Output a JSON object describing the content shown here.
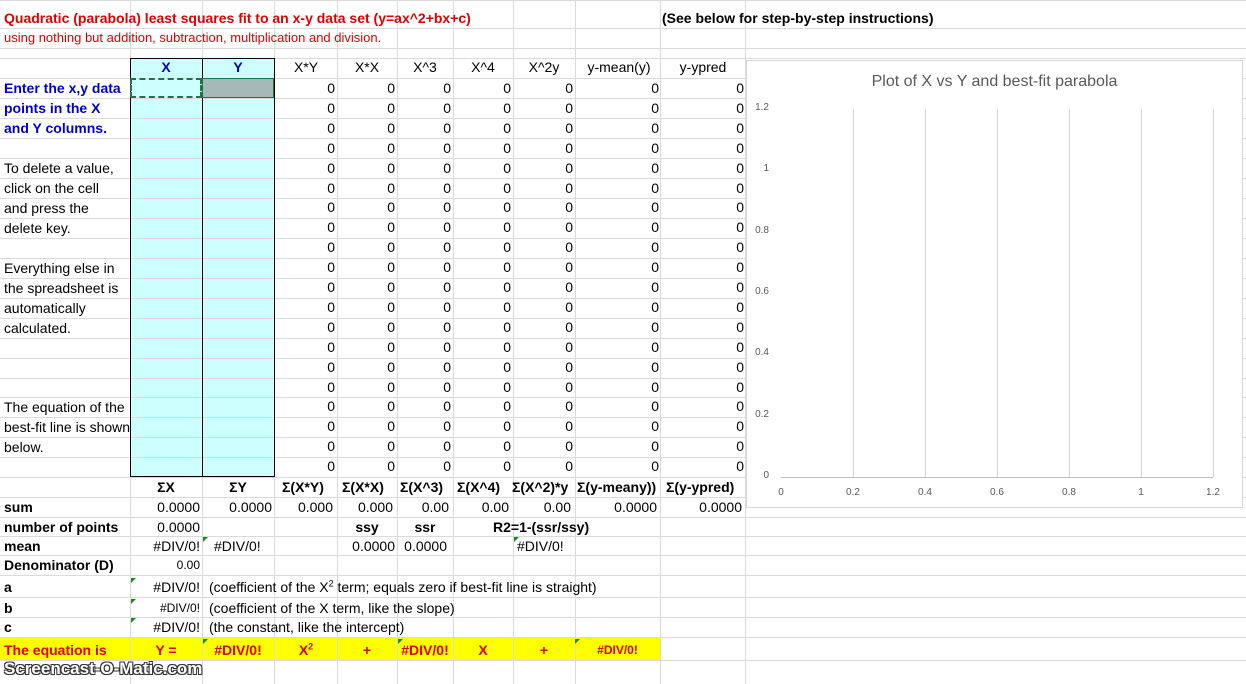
{
  "header": {
    "title": "Quadratic (parabola) least squares fit to an x-y data set (y=ax^2+bx+c)",
    "subtitle": "using nothing but addition, subtraction, multiplication and division.",
    "instructions_link": "(See below for step-by-step instructions)"
  },
  "columns": {
    "x": "X",
    "y": "Y",
    "xy": "X*Y",
    "xx": "X*X",
    "x3": "X^3",
    "x4": "X^4",
    "x2y": "X^2y",
    "ymean": "y-mean(y)",
    "ypred": "y-ypred"
  },
  "left_notes": {
    "enter1": "Enter the x,y data",
    "enter2": "points in the X",
    "enter3": "and Y columns.",
    "delete1": "To delete a value,",
    "delete2": "click on the cell",
    "delete3": "and press the",
    "delete4": "delete key.",
    "auto1": "Everything else in",
    "auto2": "the spreadsheet is",
    "auto3": "automatically",
    "auto4": "calculated.",
    "eq1": "The equation of the",
    "eq2": "best-fit line is shown",
    "eq3": "below."
  },
  "row_values": [
    "0",
    "0",
    "0",
    "0",
    "0",
    "0",
    "0"
  ],
  "sums_header": {
    "sx": "ΣX",
    "sy": "ΣY",
    "sxy": "Σ(X*Y)",
    "sxx": "Σ(X*X)",
    "sx3": "Σ(X^3)",
    "sx4": "Σ(X^4)",
    "sx2y": "Σ(X^2)*y",
    "symean": "Σ(y-meany))",
    "sypred": "Σ(y-ypred)"
  },
  "stats": {
    "sum_label": "sum",
    "sum_values": [
      "0.0000",
      "0.0000",
      "0.000",
      "0.000",
      "0.00",
      "0.00",
      "0.00",
      "0.0000",
      "0.0000"
    ],
    "npoints_label": "number of points",
    "npoints_value": "0.0000",
    "ssy_label": "ssy",
    "ssr_label": "ssr",
    "r2_label": "R2=1-(ssr/ssy)",
    "mean_label": "mean",
    "mean_x": "#DIV/0!",
    "mean_y": "#DIV/0!",
    "ssy_value": "0.0000",
    "ssr_value": "0.0000",
    "r2_value": "#DIV/0!",
    "denominator_label": "Denominator (D)",
    "denominator_value": "0.00",
    "a_label": "a",
    "a_value": "#DIV/0!",
    "a_note_pre": "(coefficient of the X",
    "a_note_sup": "2",
    "a_note_post": " term; equals zero if best-fit line is straight)",
    "b_label": "b",
    "b_value": "#DIV/0!",
    "b_note": "(coefficient of the X term, like the slope)",
    "c_label": "c",
    "c_value": "#DIV/0!",
    "c_note": "(the constant, like the intercept)"
  },
  "equation": {
    "label": "The equation is",
    "y_eq": "Y =",
    "a": "#DIV/0!",
    "x2": "X",
    "x2_sup": "2",
    "plus1": "+",
    "b": "#DIV/0!",
    "x": "X",
    "plus2": "+",
    "c": "#DIV/0!"
  },
  "watermark": "Screencast-O-Matic.com",
  "chart_data": {
    "type": "scatter",
    "title": "Plot of X vs Y and best-fit parabola",
    "xlabel": "",
    "ylabel": "",
    "xlim": [
      0,
      1.2
    ],
    "ylim": [
      0,
      1.2
    ],
    "x_ticks": [
      "0",
      "0.2",
      "0.4",
      "0.6",
      "0.8",
      "1",
      "1.2"
    ],
    "y_ticks": [
      "0",
      "0.2",
      "0.4",
      "0.6",
      "0.8",
      "1",
      "1.2"
    ],
    "grid": "vertical",
    "series": []
  }
}
